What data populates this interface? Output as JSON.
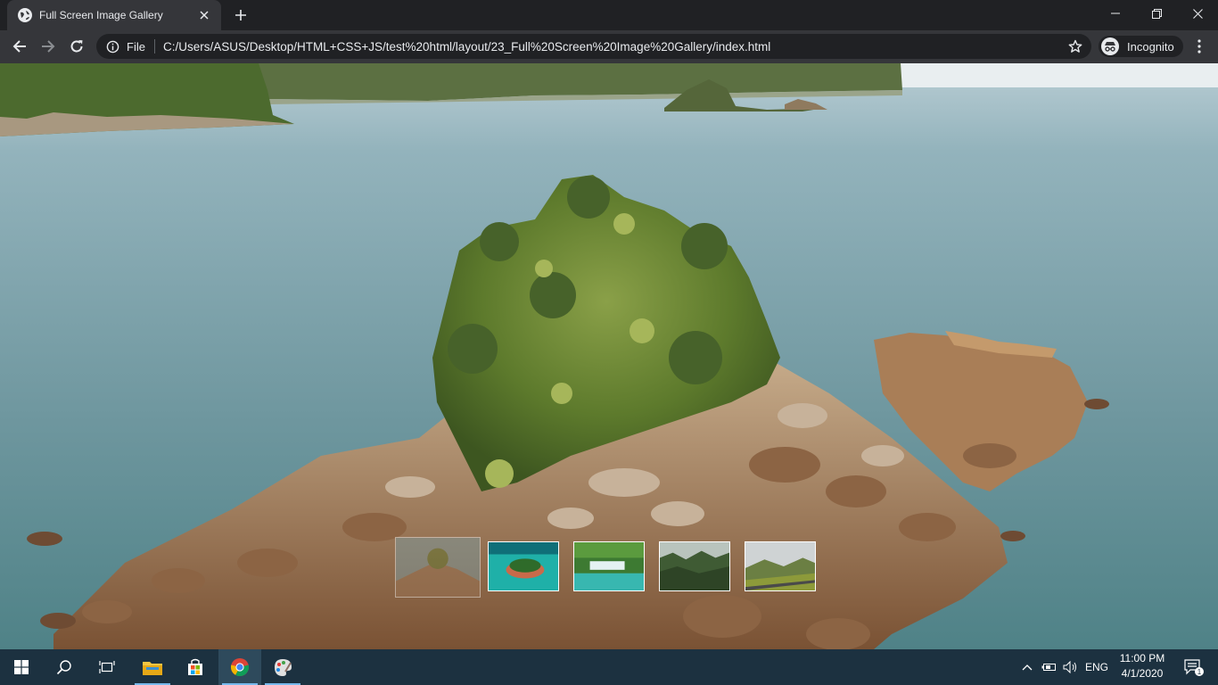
{
  "browser": {
    "tab": {
      "title": "Full Screen Image Gallery",
      "favicon": "globe-icon"
    },
    "address_bar": {
      "scheme_label": "File",
      "url": "C:/Users/ASUS/Desktop/HTML+CSS+JS/test%20html/layout/23_Full%20Screen%20Image%20Gallery/index.html"
    },
    "profile_label": "Incognito"
  },
  "gallery": {
    "current_image": "rocky-island-with-trees",
    "thumbnails": [
      {
        "subject": "rocky-island-with-trees",
        "active": true
      },
      {
        "subject": "turquoise-lagoon-island",
        "active": false
      },
      {
        "subject": "waterfall-terraces",
        "active": false
      },
      {
        "subject": "misty-forest",
        "active": false
      },
      {
        "subject": "mountain-road-cloudy-sky",
        "active": false
      }
    ]
  },
  "taskbar": {
    "apps": [
      "start-icon",
      "search-icon",
      "task-view-icon",
      "file-explorer-icon",
      "microsoft-store-icon",
      "chrome-icon",
      "paint-icon"
    ],
    "language": "ENG",
    "time": "11:00 PM",
    "date": "4/1/2020",
    "notification_count": "1"
  },
  "colors": {
    "chrome_frame": "#202124",
    "chrome_toolbar": "#35363a",
    "taskbar": "#1c3140",
    "sea": "#7fa4ad"
  }
}
